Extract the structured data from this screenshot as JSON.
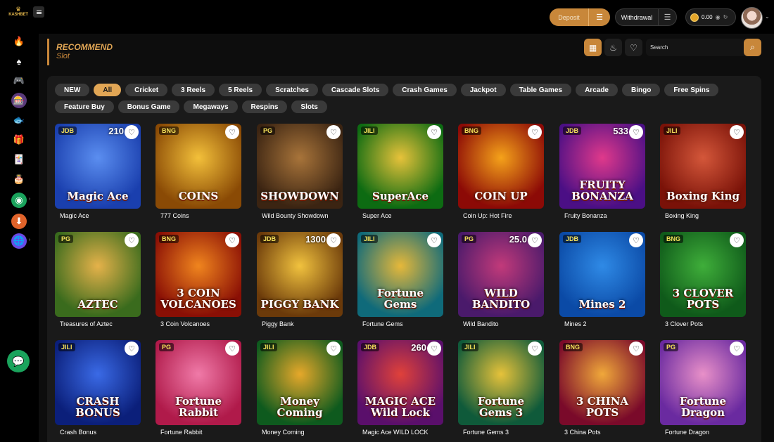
{
  "brand": {
    "logo_text": "KASHBET",
    "logo_icon": "crown-icon"
  },
  "header": {
    "deposit_label": "Deposit",
    "withdraw_label": "Withdrawal",
    "balance": "0.00",
    "menu_icon": "hamburger-icon"
  },
  "section": {
    "title": "RECOMMEND",
    "subtitle": "Slot"
  },
  "search": {
    "placeholder": "Search"
  },
  "sidebar": {
    "items": [
      {
        "icon": "hot-icon",
        "glyph": "🔥"
      },
      {
        "icon": "casino-icon",
        "glyph": "♠"
      },
      {
        "icon": "gamepad-icon",
        "glyph": "🎮"
      },
      {
        "icon": "slot-icon",
        "glyph": "🎰"
      },
      {
        "icon": "fish-icon",
        "glyph": "🐟"
      },
      {
        "icon": "lottery-icon",
        "glyph": "🎁"
      },
      {
        "icon": "card-icon",
        "glyph": "🃏"
      },
      {
        "icon": "cake-icon",
        "glyph": "🎂"
      },
      {
        "icon": "agent-icon",
        "glyph": "◉"
      },
      {
        "icon": "download-icon",
        "glyph": "⬇"
      },
      {
        "icon": "language-icon",
        "glyph": "🌐"
      }
    ]
  },
  "categories": [
    {
      "label": "NEW",
      "active": false
    },
    {
      "label": "All",
      "active": true
    },
    {
      "label": "Cricket",
      "active": false
    },
    {
      "label": "3 Reels",
      "active": false
    },
    {
      "label": "5 Reels",
      "active": false
    },
    {
      "label": "Scratches",
      "active": false
    },
    {
      "label": "Cascade Slots",
      "active": false
    },
    {
      "label": "Crash Games",
      "active": false
    },
    {
      "label": "Jackpot",
      "active": false
    },
    {
      "label": "Table Games",
      "active": false
    },
    {
      "label": "Arcade",
      "active": false
    },
    {
      "label": "Bingo",
      "active": false
    },
    {
      "label": "Free Spins",
      "active": false
    },
    {
      "label": "Feature Buy",
      "active": false
    },
    {
      "label": "Bonus Game",
      "active": false
    },
    {
      "label": "Megaways",
      "active": false
    },
    {
      "label": "Respins",
      "active": false
    },
    {
      "label": "Slots",
      "active": false
    }
  ],
  "games": [
    {
      "name": "Magic Ace",
      "provider": "JDB",
      "badge": "210",
      "art": "Magic Ace",
      "colors": [
        "#1a3fae",
        "#5b8ef0"
      ]
    },
    {
      "name": "777 Coins",
      "provider": "BNG",
      "badge": "",
      "art": "COINS",
      "colors": [
        "#8a4a05",
        "#f3c03a"
      ]
    },
    {
      "name": "Wild Bounty Showdown",
      "provider": "PG",
      "badge": "",
      "art": "SHOWDOWN",
      "colors": [
        "#3b2412",
        "#a8743a"
      ]
    },
    {
      "name": "Super Ace",
      "provider": "JILI",
      "badge": "",
      "art": "SuperAce",
      "colors": [
        "#0d6b12",
        "#e7c23a"
      ]
    },
    {
      "name": "Coin Up: Hot Fire",
      "provider": "BNG",
      "badge": "",
      "art": "COIN UP",
      "colors": [
        "#8c0a06",
        "#f5a21a"
      ]
    },
    {
      "name": "Fruity Bonanza",
      "provider": "JDB",
      "badge": "533",
      "art": "FRUITY BONANZA",
      "colors": [
        "#4b0f85",
        "#e0398b"
      ]
    },
    {
      "name": "Boxing King",
      "provider": "JILI",
      "badge": "",
      "art": "Boxing King",
      "colors": [
        "#7a1208",
        "#d4573a"
      ]
    },
    {
      "name": "Treasures of Aztec",
      "provider": "PG",
      "badge": "",
      "art": "AZTEC",
      "colors": [
        "#3a6b1d",
        "#e5b24a"
      ]
    },
    {
      "name": "3 Coin Volcanoes",
      "provider": "BNG",
      "badge": "",
      "art": "3 COIN VOLCANOES",
      "colors": [
        "#8a0f05",
        "#f0851e"
      ]
    },
    {
      "name": "Piggy Bank",
      "provider": "JDB",
      "badge": "1300",
      "art": "PIGGY BANK",
      "colors": [
        "#6b3a0a",
        "#f1c23e"
      ]
    },
    {
      "name": "Fortune Gems",
      "provider": "JILI",
      "badge": "",
      "art": "Fortune Gems",
      "colors": [
        "#0f6a7a",
        "#e6b83a"
      ]
    },
    {
      "name": "Wild Bandito",
      "provider": "PG",
      "badge": "25.0",
      "art": "WILD BANDITO",
      "colors": [
        "#4a1a6b",
        "#c23a7a"
      ]
    },
    {
      "name": "Mines 2",
      "provider": "JDB",
      "badge": "",
      "art": "Mines 2",
      "colors": [
        "#0b4aa6",
        "#2f8ae6"
      ]
    },
    {
      "name": "3 Clover Pots",
      "provider": "BNG",
      "badge": "",
      "art": "3 CLOVER POTS",
      "colors": [
        "#0f5a1a",
        "#3fae3a"
      ]
    },
    {
      "name": "Crash Bonus",
      "provider": "JILI",
      "badge": "",
      "art": "CRASH BONUS",
      "colors": [
        "#0b1f7a",
        "#3a6ae6"
      ]
    },
    {
      "name": "Fortune Rabbit",
      "provider": "PG",
      "badge": "",
      "art": "Fortune Rabbit",
      "colors": [
        "#b01a4a",
        "#f07aa8"
      ]
    },
    {
      "name": "Money Coming",
      "provider": "JILI",
      "badge": "",
      "art": "Money Coming",
      "colors": [
        "#0e5a1e",
        "#e6a82a"
      ]
    },
    {
      "name": "Magic Ace WILD LOCK",
      "provider": "JDB",
      "badge": "260",
      "art": "MAGIC ACE Wild Lock",
      "colors": [
        "#5a0f6b",
        "#e0413a"
      ]
    },
    {
      "name": "Fortune Gems 3",
      "provider": "JILI",
      "badge": "",
      "art": "Fortune Gems 3",
      "colors": [
        "#0f5a3a",
        "#e6c23a"
      ]
    },
    {
      "name": "3 China Pots",
      "provider": "BNG",
      "badge": "",
      "art": "3 CHINA POTS",
      "colors": [
        "#7a0a2a",
        "#f0a83a"
      ]
    },
    {
      "name": "Fortune Dragon",
      "provider": "PG",
      "badge": "",
      "art": "Fortune Dragon",
      "colors": [
        "#6a2aa0",
        "#e890c8"
      ]
    }
  ]
}
